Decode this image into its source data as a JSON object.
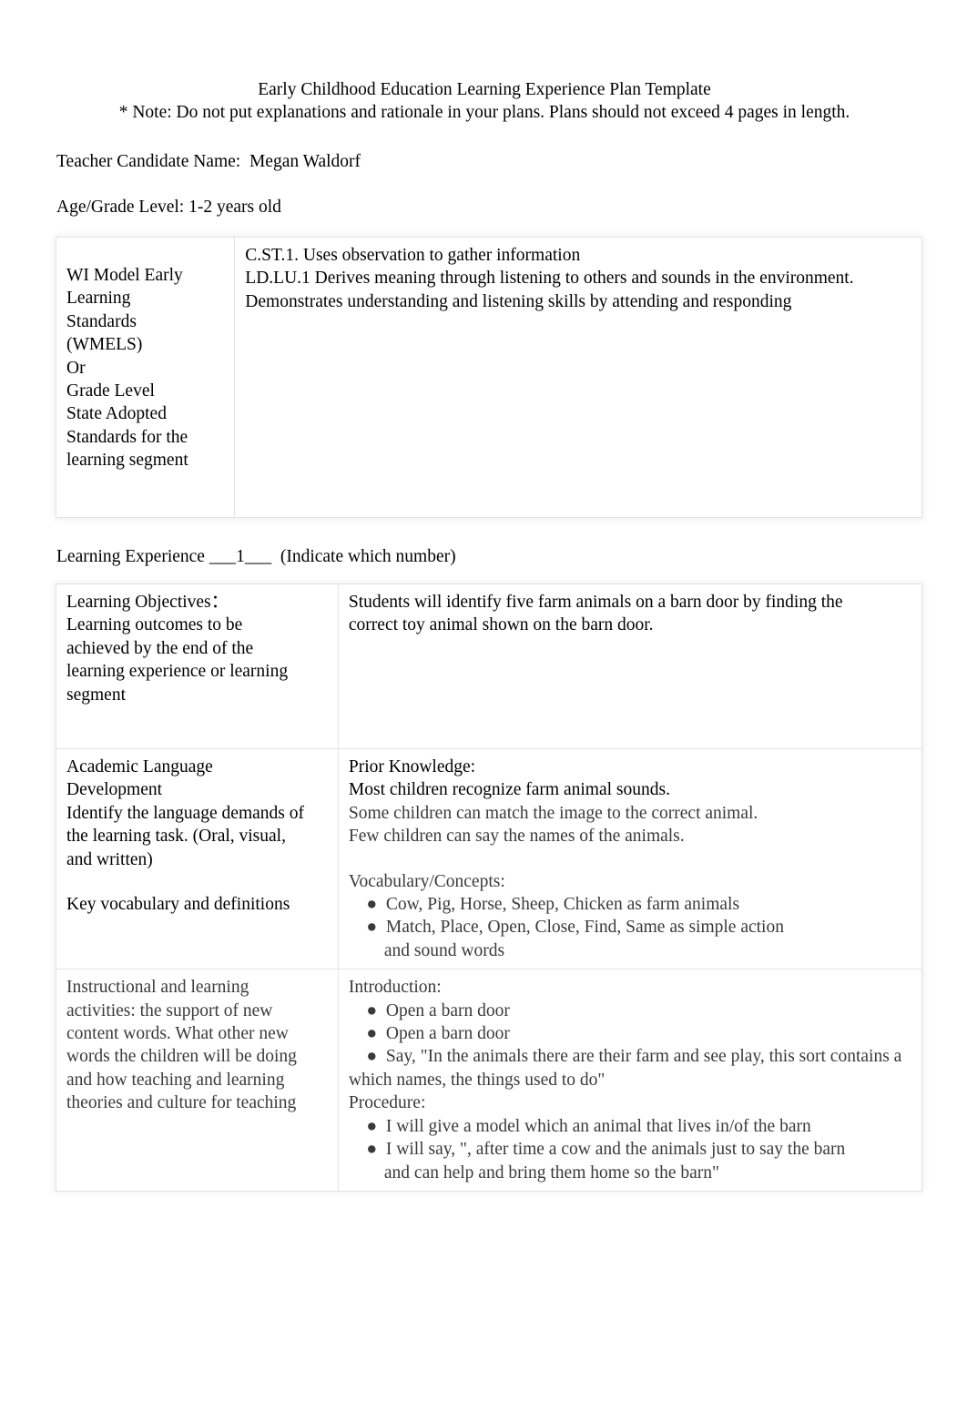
{
  "document": {
    "title_line_1": "Early Childhood Education Learning Experience Plan Template",
    "title_line_2": "* Note: Do not put explanations and rationale in your plans. Plans should not exceed 4 pages in length.",
    "teacher_candidate_line": "Teacher Candidate Name:  Megan Waldorf",
    "age_grade_line": "Age/Grade Level: 1-2 years old",
    "learning_experience_prefix": "Learning Experience ",
    "learning_experience_blank": "___1___",
    "learning_experience_suffix": "  (Indicate which number)"
  },
  "standards_table": {
    "label": "WI Model Early Learning Standards (WMELS)\nOr\nGrade Level State Adopted Standards  for the learning segment",
    "label_lines": [
      "WI Model Early",
      "Learning",
      "Standards",
      "(WMELS)",
      "Or",
      "Grade Level",
      "State Adopted",
      "Standards  for the",
      "learning segment"
    ],
    "value_lines": [
      "C.ST.1. Uses observation to gather information",
      "LD.LU.1 Derives meaning through listening to others and sounds in the environment.",
      "Demonstrates understanding and listening skills by attending and responding"
    ]
  },
  "experience_table": {
    "rows": [
      {
        "label_lines": [
          "Learning Objectives：",
          "Learning outcomes to be",
          "achieved by the end of the",
          "learning experience or learning",
          "segment"
        ],
        "value_lines": [
          "Students will identify five farm animals on a barn door by finding the",
          "correct toy animal shown on the barn door."
        ]
      },
      {
        "label_lines": [
          "Academic Language",
          "Development",
          "Identify the language demands of",
          "the learning task. (Oral, visual,",
          "and written)"
        ],
        "label_lines_2": [
          "Key vocabulary and definitions"
        ],
        "value_heading": "Prior Knowledge:",
        "value_lines": [
          "Most children recognize farm animal sounds."
        ],
        "value_lines_blurred": [
          "Some children can match the image to the correct animal.",
          "Few children can say the names of the animals."
        ],
        "value_subheading_blurred": "Vocabulary/Concepts:",
        "value_bullets_blurred": [
          "Cow, Pig, Horse, Sheep, Chicken as farm animals",
          "Match, Place, Open, Close, Find, Same as simple action",
          "and sound words"
        ]
      },
      {
        "label_lines_blurred": [
          "Instructional and learning",
          "activities: the support of new",
          "content words. What other new",
          "words the children will be doing",
          "and how teaching and learning",
          "theories and culture for teaching"
        ],
        "value_heading_blurred": "Introduction:",
        "value_bullets_blurred": [
          "Open a barn door",
          "Open a barn door",
          "Say, \"In the animals there are their farm and see play, this sort contains a which names, the things used to   do\""
        ],
        "value_subheading_blurred": "Procedure:",
        "value_bullets_2_blurred": [
          "I will give a model which an animal that lives in/of the barn",
          "I will say, \", after time a cow and the animals just to say the barn",
          "and can help and bring them home so the barn\""
        ]
      }
    ]
  }
}
